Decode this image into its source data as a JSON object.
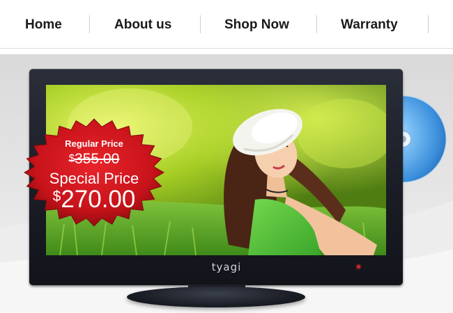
{
  "nav": {
    "items": [
      {
        "label": "Home"
      },
      {
        "label": "About us"
      },
      {
        "label": "Shop Now"
      },
      {
        "label": "Warranty"
      }
    ]
  },
  "hero": {
    "tv_brand": "tyagi",
    "badge": {
      "regular_label": "Regular Price",
      "regular_currency": "$",
      "regular_amount": "355.00",
      "special_label": "Special Price",
      "special_currency": "$",
      "special_amount": "270.00"
    }
  },
  "colors": {
    "badge_red": "#c8131a",
    "tv_bezel": "#1c1f27",
    "disc_blue": "#4aa3ec",
    "nav_text": "#1a1a1a"
  }
}
